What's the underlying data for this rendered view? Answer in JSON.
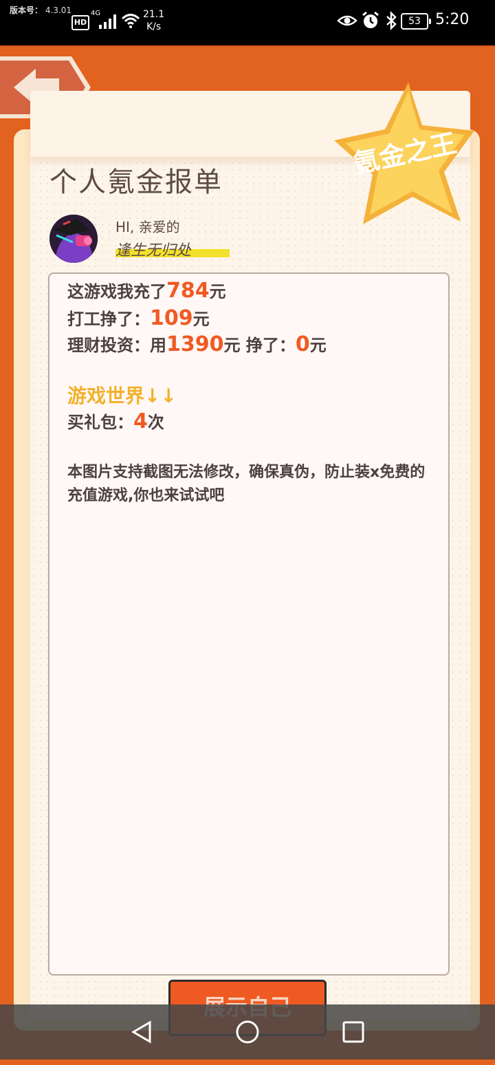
{
  "status_bar": {
    "version_label": "版本号：",
    "version_value": "4.3.01",
    "hd": "HD",
    "network": "4G",
    "speed_value": "21.1",
    "speed_unit": "K/s",
    "battery": "53",
    "time": "5:20"
  },
  "page": {
    "title": "个人氪金报单",
    "badge_text": "氪金之王",
    "greeting": "HI, 亲爱的",
    "username": "逢生无归处"
  },
  "report": {
    "line1_prefix": "这游戏我充了",
    "line1_value": "784",
    "line1_unit": "元",
    "line2_prefix": "打工挣了：",
    "line2_value": "109",
    "line2_unit": "元",
    "line3_prefix": "理财投资：用",
    "line3_value1": "1390",
    "line3_mid": "元 挣了：",
    "line3_value2": "0",
    "line3_unit": "元",
    "section_title": "游戏世界↓↓",
    "gift_prefix": "买礼包：",
    "gift_value": "4",
    "gift_unit": "次",
    "note": "本图片支持截图无法修改，确保真伪，防止装x免费的充值游戏,你也来试试吧"
  },
  "actions": {
    "show_button": "展示自己"
  },
  "colors": {
    "accent": "#f05a22",
    "frame": "#d8531a",
    "section_title": "#f3b12b",
    "username_highlight": "#f2e12a"
  }
}
